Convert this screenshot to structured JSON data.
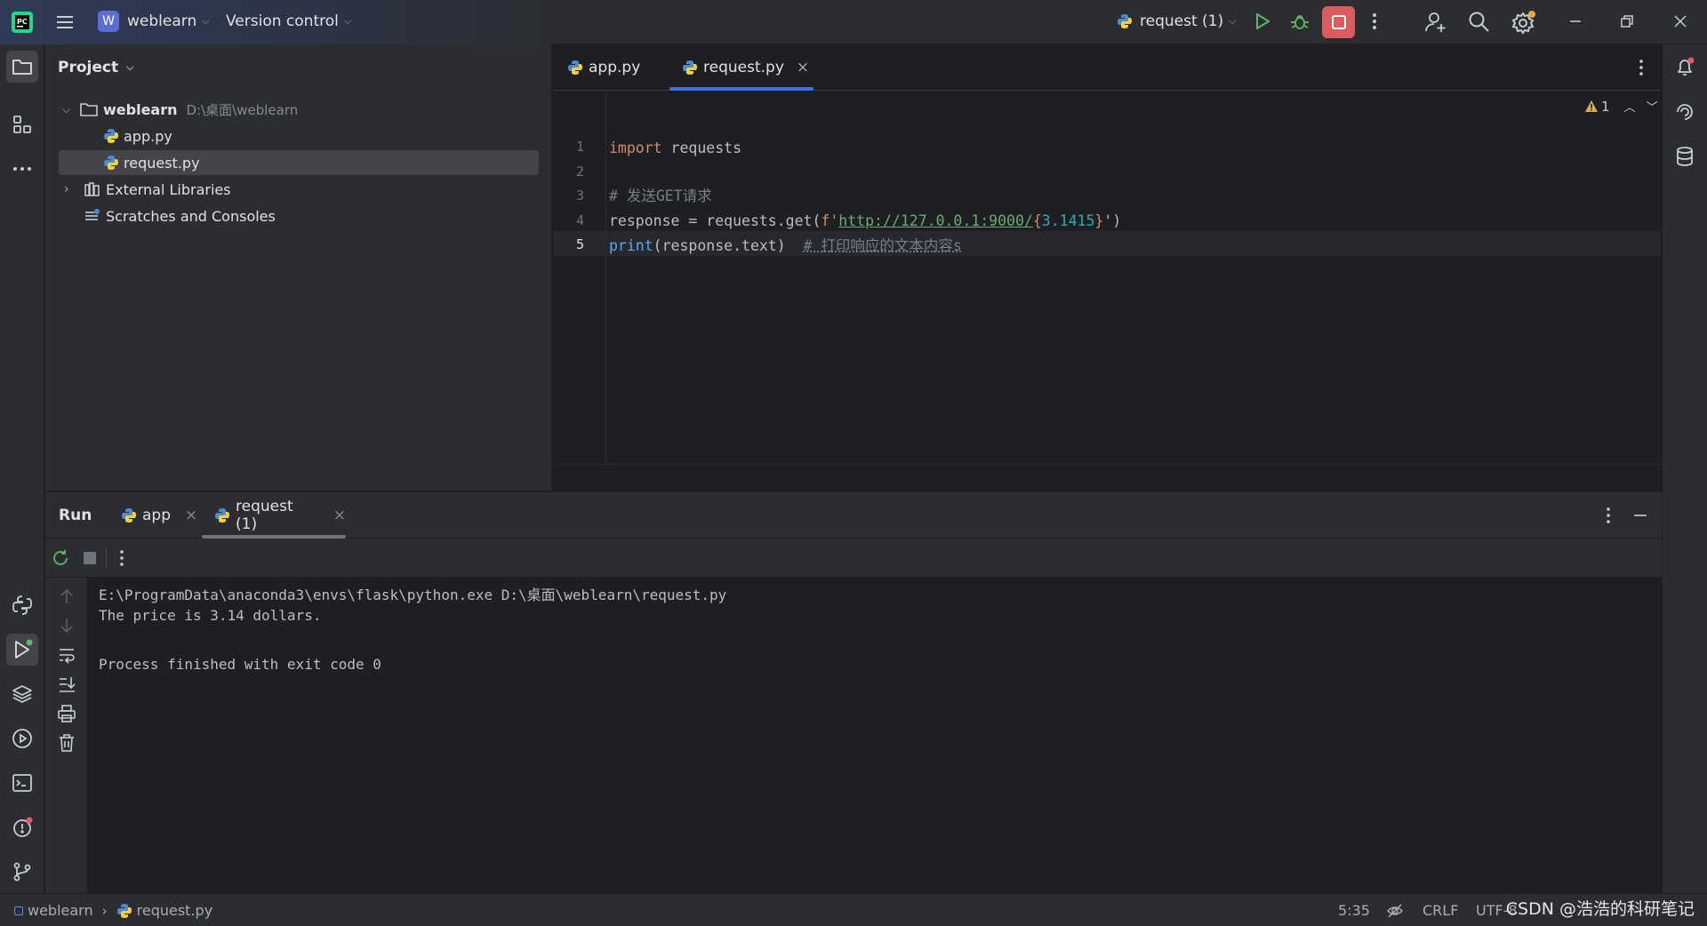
{
  "titlebar": {
    "project_badge": "W",
    "project_name": "weblearn",
    "vcs_label": "Version control",
    "run_config": "request (1)"
  },
  "project_panel": {
    "title": "Project",
    "tree": [
      {
        "label": "weblearn",
        "path": "D:\\桌面\\weblearn"
      },
      {
        "label": "app.py"
      },
      {
        "label": "request.py"
      },
      {
        "label": "External Libraries"
      },
      {
        "label": "Scratches and Consoles"
      }
    ]
  },
  "editor": {
    "tabs": [
      {
        "label": "app.py"
      },
      {
        "label": "request.py",
        "close": "×"
      }
    ],
    "warning_count": "1",
    "line_numbers": [
      "1",
      "2",
      "3",
      "4",
      "5"
    ],
    "code": {
      "l1_kw": "import",
      "l1_rest": " requests",
      "l3_comment": "# 发送GET请求",
      "l4_pre": "response = requests.get(",
      "l4_fprefix": "f'",
      "l4_url": "http://127.0.0.1:9000/",
      "l4_brace_open": "{",
      "l4_num": "3.1415",
      "l4_brace_close": "}",
      "l4_post": "')",
      "l5_fn": "print",
      "l5_args": "(response.text)  ",
      "l5_comment": "# 打印响应的文本内容s"
    }
  },
  "run_panel": {
    "title": "Run",
    "tabs": [
      {
        "label": "app",
        "close": "×"
      },
      {
        "label": "request (1)",
        "close": "×"
      }
    ],
    "console": [
      "E:\\ProgramData\\anaconda3\\envs\\flask\\python.exe D:\\桌面\\weblearn\\request.py",
      "The price is 3.14 dollars.",
      "",
      "Process finished with exit code 0"
    ]
  },
  "statusbar": {
    "project": "weblearn",
    "file": "request.py",
    "position": "5:35",
    "line_sep": "CRLF",
    "encoding": "UTF-8"
  },
  "watermark": "CSDN @浩浩的科研笔记",
  "colors": {
    "accent": "#3574f0",
    "stop_button": "#db5c5c",
    "run_green": "#5fb865",
    "badge_orange": "#f2a43a",
    "notification_red": "#e55765"
  }
}
